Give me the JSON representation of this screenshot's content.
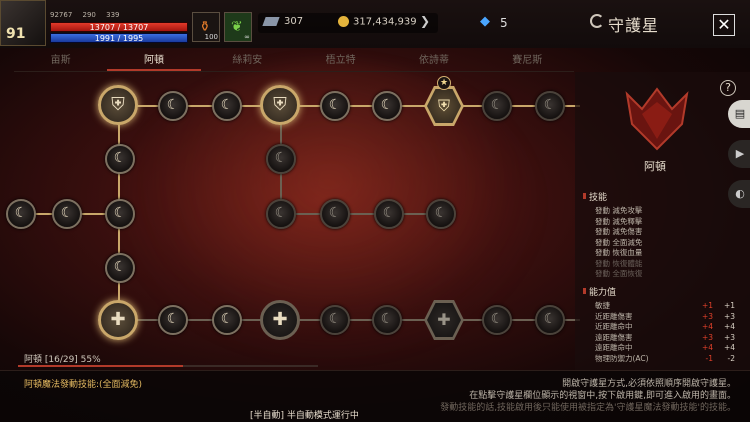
{
  "player": {
    "level": "91",
    "stat1": "92767",
    "stat2": "290",
    "stat3": "339",
    "hp": "13707 / 13707",
    "mp": "1991 / 1995",
    "hp_fraction": 1.0,
    "mp_fraction": 0.998
  },
  "slots": [
    {
      "count": "100"
    },
    {
      "count": "∞"
    }
  ],
  "currency": {
    "gems": "307",
    "gold": "317,434,939",
    "crystals": "5"
  },
  "window": {
    "title": "守護星",
    "close": "✕"
  },
  "tabs": [
    "亩斯",
    "阿頓",
    "絲莉安",
    "梧立特",
    "依詩蒂",
    "賽尼斯"
  ],
  "active_tab": 1,
  "tree": {
    "progress_text": "阿頓 [16/29] 55%",
    "progress_fraction": 0.55
  },
  "side_panel": {
    "name": "阿頓",
    "help": "?",
    "skills_title": "技能",
    "skills": [
      "發動 減免攻擊",
      "發動 減免釋擊",
      "發動 減免傷害",
      "發動 全面減免",
      "發動 恢復血量",
      "發動 恢復體能",
      "發動 全面恢復"
    ],
    "skills_faded_from": 5,
    "attr_title": "能力值",
    "attrs": [
      {
        "name": "敏捷",
        "a": "+1",
        "b": "+1"
      },
      {
        "name": "近距離傷害",
        "a": "+3",
        "b": "+3"
      },
      {
        "name": "近距離命中",
        "a": "+4",
        "b": "+4"
      },
      {
        "name": "遠距離傷害",
        "a": "+3",
        "b": "+3"
      },
      {
        "name": "遠距離命中",
        "a": "+4",
        "b": "+4"
      },
      {
        "name": "物理防禦力(AC)",
        "a": "-1",
        "b": "-2"
      }
    ]
  },
  "bottom": {
    "skill_line": "阿頓魔法發動技能:(全面減免)",
    "info": [
      "開啟守護星方式,必須依照順序開啟守護星。",
      "在點擊守護星欄位顯示的視窗中,按下啟用鍵,即可進入啟用的畫面。",
      "發動技能的話,技能啟用後只能使用被指定為'守護星魔法發動技能'的技能。"
    ],
    "status": "[半自動] 半自動模式運行中"
  },
  "colors": {
    "accent": "#b23a2a",
    "gold": "#c9a76a",
    "hp": "#e23a2a",
    "mp": "#3b6ee0"
  }
}
